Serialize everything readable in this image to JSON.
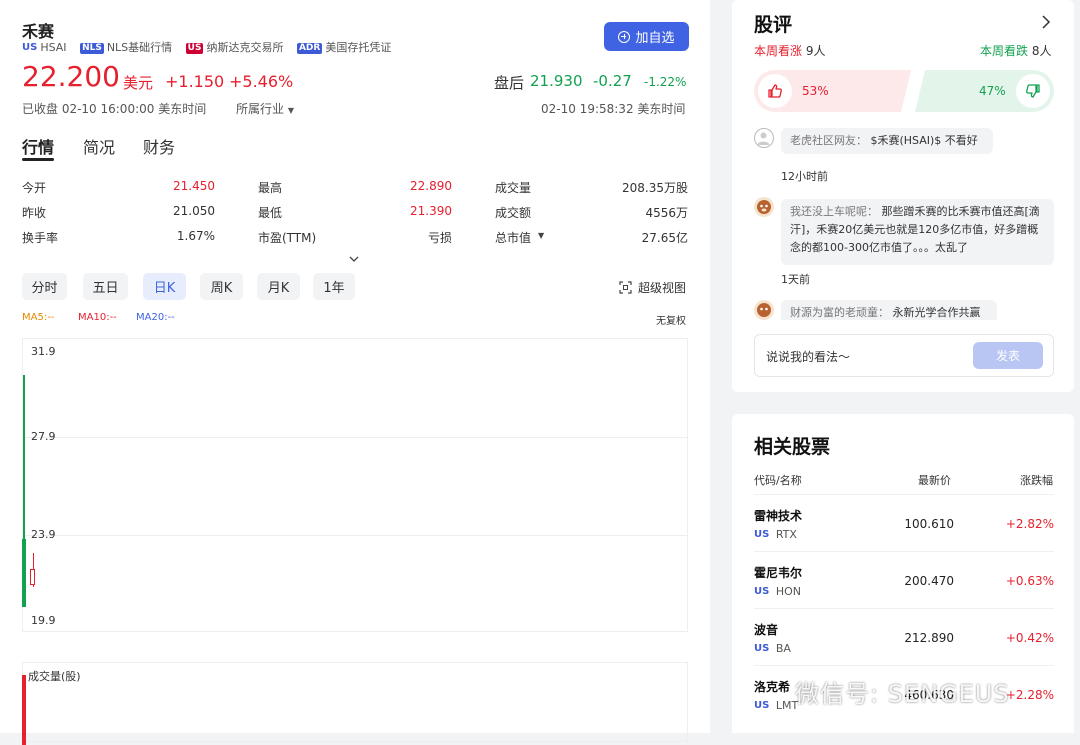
{
  "stock": {
    "name": "禾赛",
    "ticker_market": "US",
    "ticker": "HSAI",
    "tags": [
      "NLS基础行情",
      "纳斯达克交易所",
      "美国存托凭证"
    ],
    "tag_badges": [
      "NLS",
      "US",
      "ADR"
    ],
    "price": "22.200",
    "currency": "美元",
    "change": "+1.150",
    "change_pct": "+5.46%",
    "close_status": "已收盘 02-10 16:00:00 美东时间",
    "industry_label": "所属行业",
    "after_label": "盘后",
    "after_price": "21.930",
    "after_change": "-0.27",
    "after_change_pct": "-1.22%",
    "after_time": "02-10 19:58:32 美东时间",
    "watch_button": "加自选"
  },
  "tabs": [
    "行情",
    "简况",
    "财务"
  ],
  "quote": [
    {
      "label": "今开",
      "value": "21.450",
      "color": "red"
    },
    {
      "label": "最高",
      "value": "22.890",
      "color": "red"
    },
    {
      "label": "成交量",
      "value": "208.35万股",
      "color": "dark"
    },
    {
      "label": "昨收",
      "value": "21.050",
      "color": "dark"
    },
    {
      "label": "最低",
      "value": "21.390",
      "color": "red"
    },
    {
      "label": "成交额",
      "value": "4556万",
      "color": "dark"
    },
    {
      "label": "换手率",
      "value": "1.67%",
      "color": "dark"
    },
    {
      "label": "市盈(TTM)",
      "value": "亏损",
      "color": "dark"
    },
    {
      "label": "总市值",
      "value": "27.65亿",
      "color": "dark"
    }
  ],
  "periods": [
    "分时",
    "五日",
    "日K",
    "周K",
    "月K",
    "1年"
  ],
  "active_period": "日K",
  "super_view": "超级视图",
  "ma": {
    "ma5": "MA5:--",
    "ma10": "MA10:--",
    "ma20": "MA20:--",
    "ma5_color": "#e68a00",
    "ma10_color": "#e6202e",
    "ma20_color": "#3f63e3"
  },
  "adjust": "无复权",
  "chart_data": {
    "type": "candlestick",
    "y_ticks": [
      "31.9",
      "27.9",
      "23.9",
      "19.9"
    ],
    "ylim": [
      19.9,
      31.9
    ],
    "candles": [
      {
        "open": 21.45,
        "close": 22.2,
        "high": 22.89,
        "low": 21.39,
        "direction": "up"
      }
    ],
    "volume_label": "成交量(股)"
  },
  "comments": {
    "title": "股评",
    "bull_label": "本周看涨",
    "bull_count": "9人",
    "bear_label": "本周看跌",
    "bear_count": "8人",
    "bull_pct": "53%",
    "bear_pct": "47%",
    "items": [
      {
        "author": "老虎社区网友：",
        "text": "$禾赛(HSAI)$ 不看好",
        "time": "12小时前"
      },
      {
        "author": "我还没上车呢呢：",
        "text": "那些蹭禾赛的比禾赛市值还高[滴汗]，禾赛20亿美元也就是120多亿市值，好多蹭概念的都100-300亿市值了。。。太乱了",
        "time": "1天前"
      },
      {
        "author": "财源为富的老顽童：",
        "text": "永新光学合作共赢"
      }
    ],
    "input_placeholder": "说说我的看法～",
    "post_button": "发表"
  },
  "related": {
    "title": "相关股票",
    "headers": [
      "代码/名称",
      "最新价",
      "涨跌幅"
    ],
    "rows": [
      {
        "name": "雷神技术",
        "market": "US",
        "code": "RTX",
        "price": "100.610",
        "change": "+2.82%"
      },
      {
        "name": "霍尼韦尔",
        "market": "US",
        "code": "HON",
        "price": "200.470",
        "change": "+0.63%"
      },
      {
        "name": "波音",
        "market": "US",
        "code": "BA",
        "price": "212.890",
        "change": "+0.42%"
      },
      {
        "name": "洛克希",
        "market": "US",
        "code": "LMT",
        "price": "460.630",
        "change": "+2.28%"
      }
    ]
  },
  "watermark": "微信号: SENGEUS"
}
